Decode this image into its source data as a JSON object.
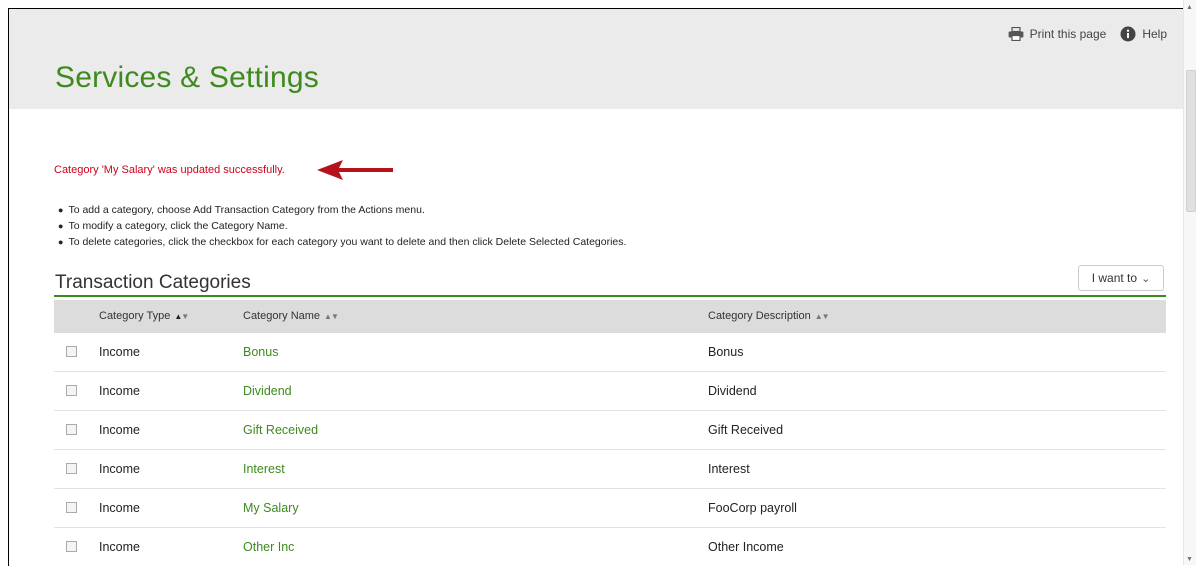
{
  "header": {
    "title": "Services & Settings",
    "print_label": "Print this page",
    "help_label": "Help"
  },
  "message": {
    "success": "Category 'My Salary' was updated successfully."
  },
  "instructions": [
    "To add a category, choose Add Transaction Category from the Actions menu.",
    "To modify a category, click the Category Name.",
    "To delete categories, click the checkbox for each category you want to delete and then click Delete Selected Categories."
  ],
  "section": {
    "title": "Transaction Categories",
    "action_label": "I want to"
  },
  "table": {
    "columns": [
      "Category Type",
      "Category Name",
      "Category Description"
    ],
    "rows": [
      {
        "type": "Income",
        "name": "Bonus",
        "description": "Bonus"
      },
      {
        "type": "Income",
        "name": "Dividend",
        "description": "Dividend"
      },
      {
        "type": "Income",
        "name": "Gift Received",
        "description": "Gift Received"
      },
      {
        "type": "Income",
        "name": "Interest",
        "description": "Interest"
      },
      {
        "type": "Income",
        "name": "My Salary",
        "description": "FooCorp payroll"
      },
      {
        "type": "Income",
        "name": "Other Inc",
        "description": "Other Income"
      }
    ]
  },
  "colors": {
    "brand_green": "#3d8b1e",
    "success_red": "#d0021b",
    "arrow_red": "#b5121b",
    "header_band": "#ebebeb",
    "table_header": "#dcdcdc"
  },
  "icons": {
    "print": "printer-icon",
    "help": "info-circle-icon",
    "dropdown": "chevron-down-icon",
    "sort": "sort-arrows-icon"
  }
}
